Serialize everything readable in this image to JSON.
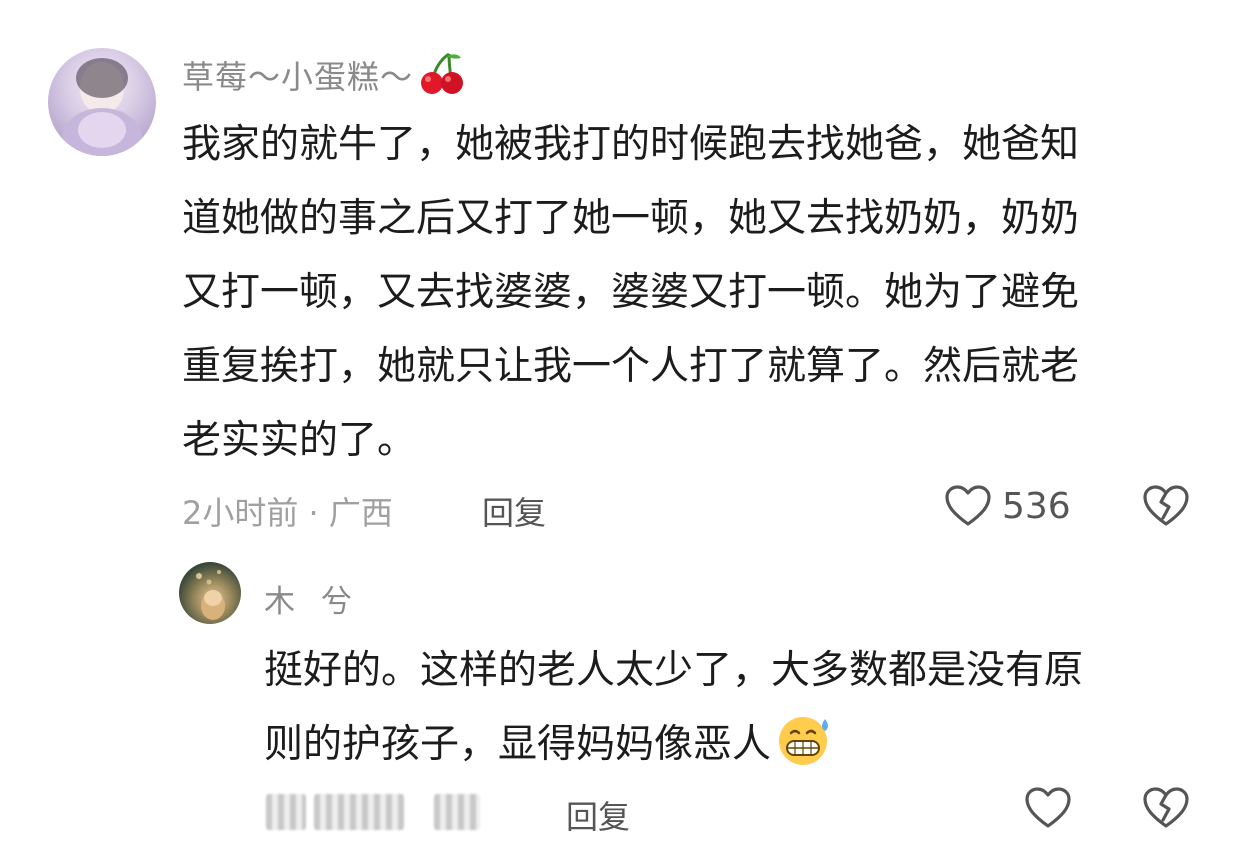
{
  "comment": {
    "username": "草莓～小蛋糕～",
    "username_emoji": "cherry-icon",
    "lines": [
      "我家的就牛了，她被我打的时候跑去找她爸，她爸知",
      "道她做的事之后又打了她一顿，她又去找奶奶，奶奶",
      "又打一顿，又去找婆婆，婆婆又打一顿。她为了避免",
      "重复挨打，她就只让我一个人打了就算了。然后就老",
      "老实实的了。"
    ],
    "meta": "2小时前 · 广西",
    "reply_label": "回复",
    "like_count": "536"
  },
  "reply": {
    "username": "木 兮",
    "lines": [
      "挺好的。这样的老人太少了，大多数都是没有原",
      "则的护孩子，显得妈妈像恶人"
    ],
    "trailing_emoji": "grinning-sweat-emoji-icon",
    "reply_label": "回复"
  },
  "colors": {
    "username": "#8a8a8a",
    "body_text": "#1c1c1c",
    "meta": "#a0a0a0",
    "icon_stroke": "#555555"
  }
}
